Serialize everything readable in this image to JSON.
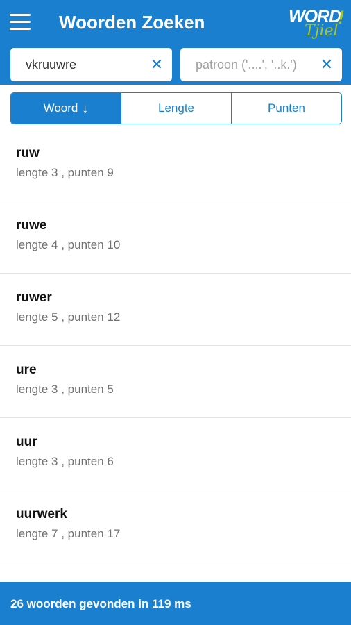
{
  "header": {
    "title": "Woorden Zoeken",
    "logo_word": "WORD",
    "logo_bang": "!",
    "logo_sub": "Tjiel",
    "color": "#1a7fcf",
    "accent": "#a4c72b"
  },
  "search": {
    "letters_value": "vkruuwre",
    "pattern_value": "",
    "pattern_placeholder": "patroon ('....', '..k.')",
    "clear_icon": "close-icon"
  },
  "sort": {
    "tabs": [
      {
        "label": "Woord",
        "active": true,
        "icon": "arrow-down-icon"
      },
      {
        "label": "Lengte",
        "active": false
      },
      {
        "label": "Punten",
        "active": false
      }
    ],
    "arrow": "↓"
  },
  "results": [
    {
      "word": "ruw",
      "info": "lengte 3 , punten 9"
    },
    {
      "word": "ruwe",
      "info": "lengte 4 , punten 10"
    },
    {
      "word": "ruwer",
      "info": "lengte 5 , punten 12"
    },
    {
      "word": "ure",
      "info": "lengte 3 , punten 5"
    },
    {
      "word": "uur",
      "info": "lengte 3 , punten 6"
    },
    {
      "word": "uurwerk",
      "info": "lengte 7 , punten 17"
    }
  ],
  "footer": {
    "status": "26 woorden gevonden in 119 ms"
  }
}
